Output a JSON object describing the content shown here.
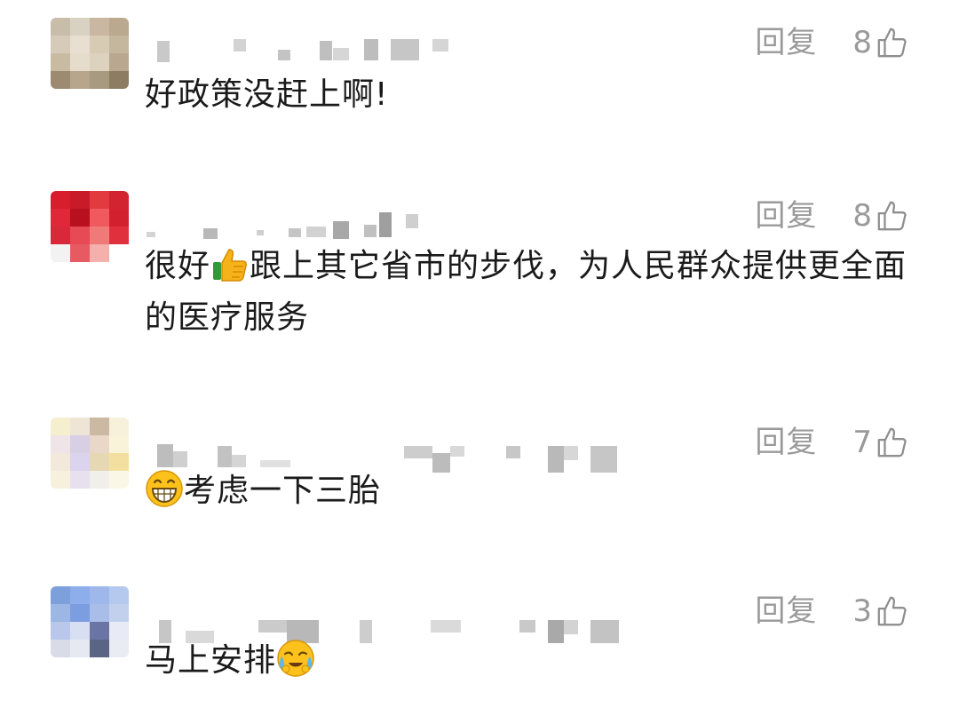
{
  "comments": [
    {
      "reply_label": "回复",
      "likes": "8",
      "text": "好政策没赶上啊!",
      "avatar_colors": [
        "#c8bda8",
        "#d9d2c2",
        "#c9b7a1",
        "#bba98f",
        "#d6cbb8",
        "#e8dfd1",
        "#d8cbb3",
        "#c5b69e",
        "#c9bba2",
        "#e6dccb",
        "#ddd2bd",
        "#b9a88f",
        "#9c8b70",
        "#b7a68c",
        "#a89a80",
        "#8d7c62"
      ]
    },
    {
      "reply_label": "回复",
      "likes": "8",
      "text_before": "很好",
      "emoji": "thumbs-up",
      "text_after": "跟上其它省市的步伐，为人民群众提供更全面的医疗服务",
      "avatar_colors": [
        "#d81e2c",
        "#c81a28",
        "#e33a40",
        "#d22430",
        "#e0283a",
        "#b8101f",
        "#f05a5e",
        "#d2202e",
        "#d8283a",
        "#e84a55",
        "#f07a78",
        "#e0303e",
        "#f2f2f2",
        "#e85a62",
        "#f4b0aa",
        "#ffffff"
      ]
    },
    {
      "reply_label": "回复",
      "likes": "7",
      "emoji": "grinning-face",
      "text_after": "考虑一下三胎",
      "avatar_colors": [
        "#f6efcf",
        "#efe5d7",
        "#cbb9a3",
        "#f7f1dc",
        "#efe4e7",
        "#d9cfe4",
        "#e9d7c8",
        "#f9f3d9",
        "#f3e8dc",
        "#dcd3ef",
        "#e7d8b4",
        "#f3e0a0",
        "#f6f0dc",
        "#e7e0ef",
        "#f1efea",
        "#fbf7e7"
      ]
    },
    {
      "reply_label": "回复",
      "likes": "3",
      "text_before": "马上安排",
      "emoji": "crying-face",
      "avatar_colors": [
        "#7d9fdc",
        "#8daeea",
        "#9fb8ec",
        "#b5c9ef",
        "#9cb6e6",
        "#7c9de0",
        "#a8bde8",
        "#c2d0ee",
        "#b9c7ea",
        "#d8dff2",
        "#6a75a6",
        "#e8ebf5",
        "#d9dbe8",
        "#e7e9f2",
        "#5a6585",
        "#e9ecf3"
      ]
    }
  ]
}
